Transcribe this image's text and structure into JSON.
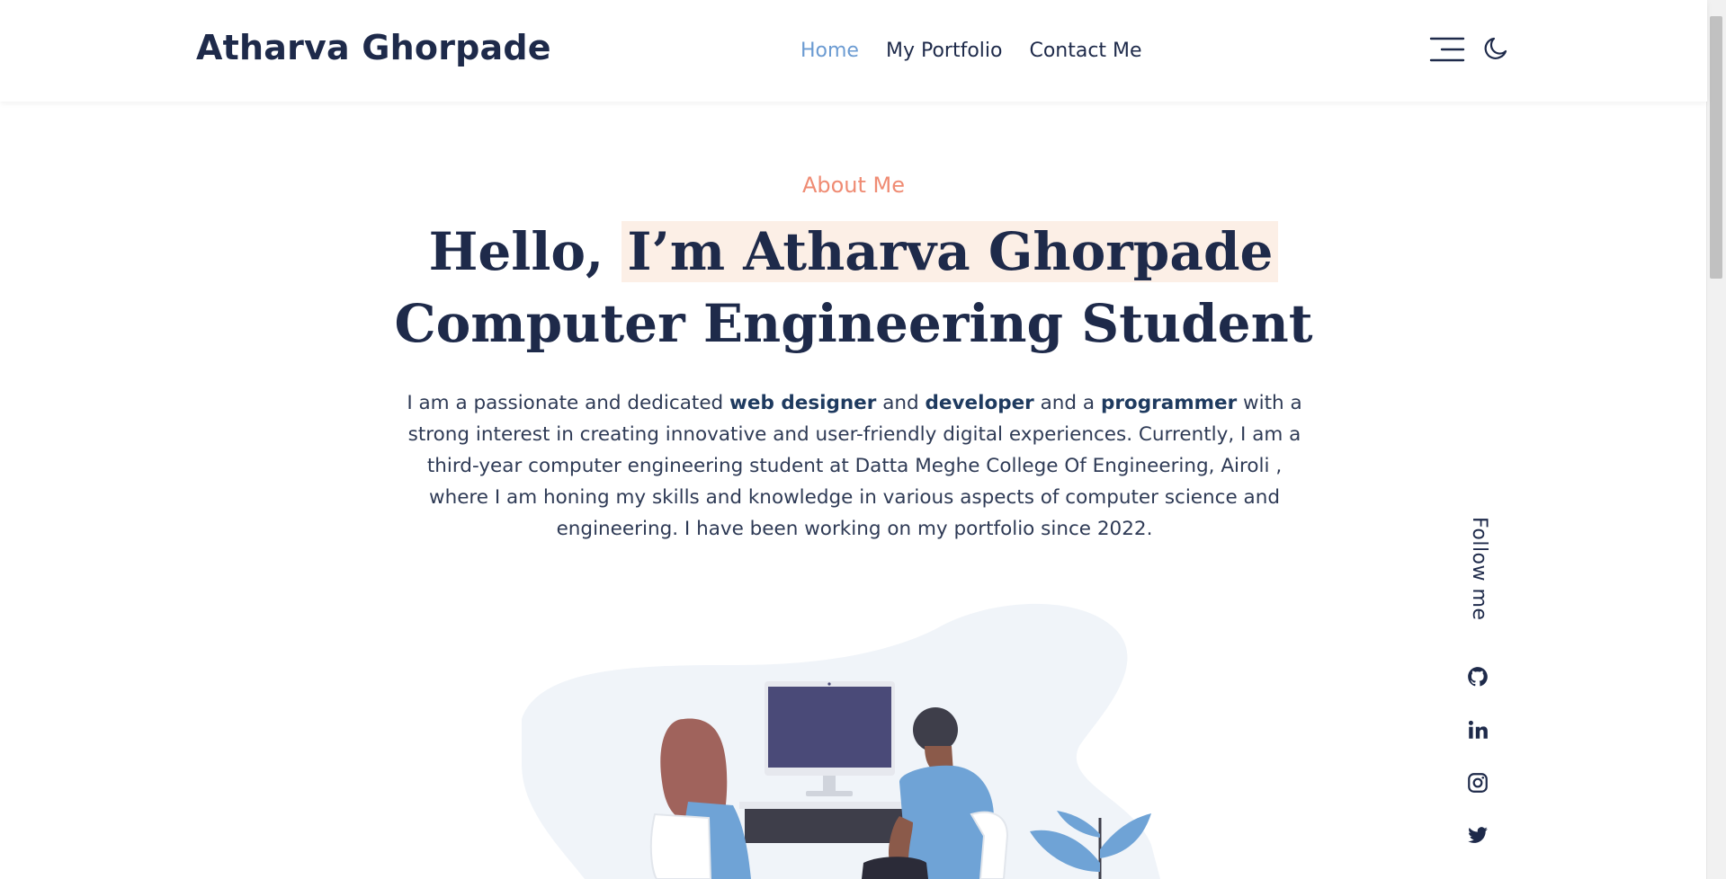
{
  "header": {
    "brand": "Atharva Ghorpade",
    "nav": [
      {
        "label": "Home",
        "active": true
      },
      {
        "label": "My Portfolio",
        "active": false
      },
      {
        "label": "Contact Me",
        "active": false
      }
    ],
    "menu_icon": "hamburger-menu-icon",
    "theme_icon": "moon-icon"
  },
  "hero": {
    "eyebrow": "About Me",
    "headline_prefix": "Hello, ",
    "headline_highlight": "I’m Atharva Ghorpade",
    "headline_line2": "Computer Engineering Student",
    "bio": {
      "t1": "I am a passionate and dedicated ",
      "b1": "web designer",
      "t2": " and ",
      "b2": "developer",
      "t3": " and a ",
      "b3": "programmer",
      "t4": " with a strong interest in creating innovative and user-friendly digital experiences. Currently, I am a third-year computer engineering student at Datta Meghe College Of Engineering, Airoli , where I am honing my skills and knowledge in various aspects of computer science and engineering. I have been working on my portfolio since 2022."
    }
  },
  "follow": {
    "label": "Follow me",
    "icons": [
      "github-icon",
      "linkedin-icon",
      "instagram-icon",
      "twitter-icon"
    ]
  },
  "colors": {
    "accent_nav": "#6b9bd2",
    "eyebrow": "#ef8b73",
    "text_dark": "#1e2a4a",
    "highlight_bg": "#fcefe6"
  }
}
